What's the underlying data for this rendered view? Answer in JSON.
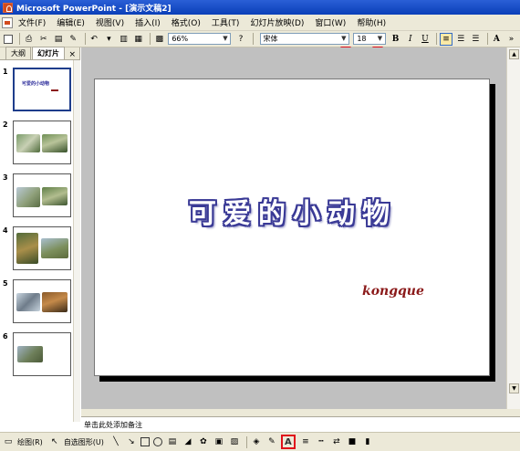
{
  "window": {
    "title": "Microsoft PowerPoint - [演示文稿2]"
  },
  "menu": [
    "文件(F)",
    "编辑(E)",
    "视图(V)",
    "插入(I)",
    "格式(O)",
    "工具(T)",
    "幻灯片放映(D)",
    "窗口(W)",
    "帮助(H)"
  ],
  "toolbar": {
    "zoom": "66%",
    "font_name": "宋体",
    "font_size": "18",
    "bold_label": "B",
    "italic_label": "I",
    "underline_label": "U",
    "font_grow_label": "A"
  },
  "panel": {
    "tabs": [
      "大纲",
      "幻灯片"
    ],
    "close_label": "×",
    "slides": [
      {
        "number": "1",
        "mini_title": "可爱的小动物"
      },
      {
        "number": "2"
      },
      {
        "number": "3"
      },
      {
        "number": "4"
      },
      {
        "number": "5"
      },
      {
        "number": "6"
      }
    ]
  },
  "slide": {
    "title": "可爱的小动物",
    "subtitle": "kongque"
  },
  "notes": {
    "placeholder": "单击此处添加备注"
  },
  "drawing_toolbar": {
    "draw_label": "绘图(R)",
    "autoshapes_label": "自选图形(U)",
    "font_color_label": "A"
  },
  "colors": {
    "title_outline": "#3a3a96",
    "subtitle": "#8b1a1a",
    "highlight_marks": "#e0101a"
  }
}
